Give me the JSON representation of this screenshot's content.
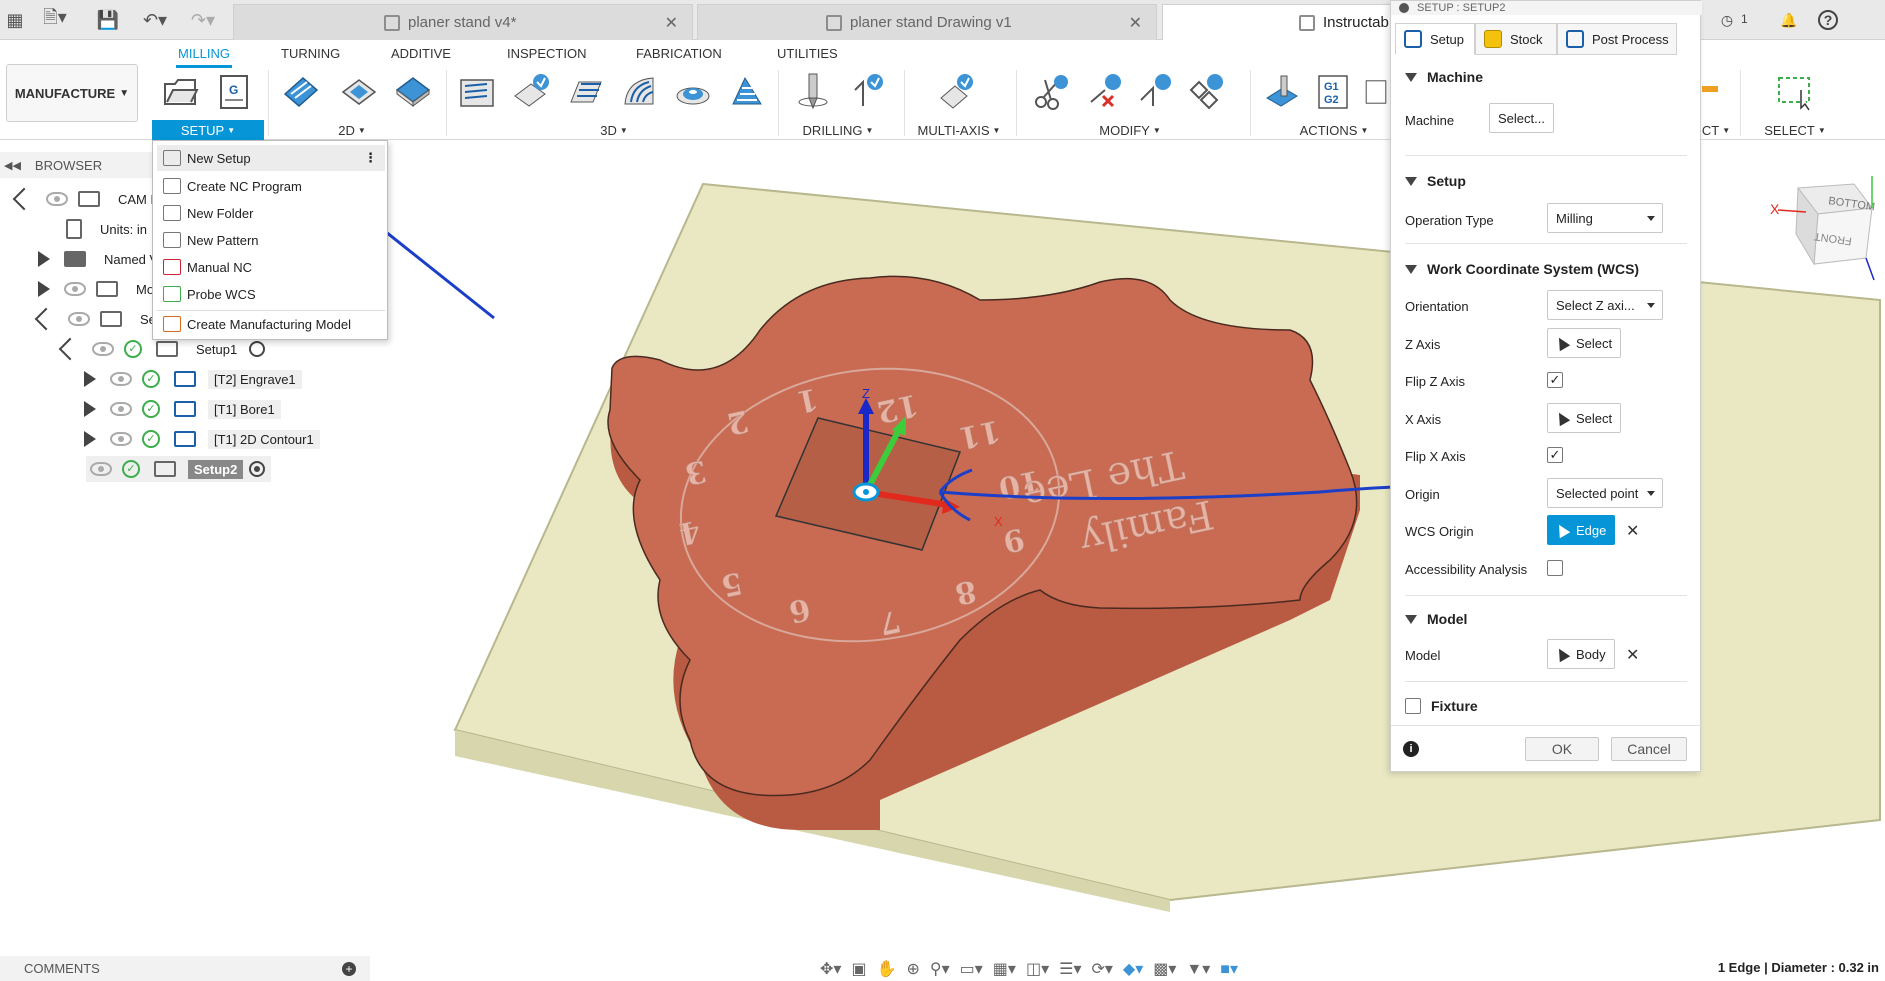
{
  "tabs": [
    {
      "label": "planer stand v4*"
    },
    {
      "label": "planer stand Drawing v1"
    },
    {
      "label": "Instructab"
    }
  ],
  "status_counter": "1",
  "workspace": {
    "label": "MANUFACTURE"
  },
  "ribbon_tabs": [
    "MILLING",
    "TURNING",
    "ADDITIVE",
    "INSPECTION",
    "FABRICATION",
    "UTILITIES"
  ],
  "groups": {
    "setup": "SETUP",
    "twod": "2D",
    "threed": "3D",
    "drilling": "DRILLING",
    "multiaxis": "MULTI-AXIS",
    "modify": "MODIFY",
    "actions": "ACTIONS",
    "inspect": "CT",
    "select": "SELECT"
  },
  "g1g2_label": [
    "G1",
    "G2"
  ],
  "browser": {
    "title": "BROWSER",
    "items": [
      {
        "label": "CAM R"
      },
      {
        "label": "Units: in"
      },
      {
        "label": "Named V"
      },
      {
        "label": "Mo"
      },
      {
        "label": "Se"
      },
      {
        "label": "Setup1"
      },
      {
        "label": "[T2] Engrave1"
      },
      {
        "label": "[T1] Bore1"
      },
      {
        "label": "[T1] 2D Contour1"
      },
      {
        "label": "Setup2"
      }
    ]
  },
  "setup_menu": {
    "items": [
      {
        "label": "New Setup"
      },
      {
        "label": "Create NC Program"
      },
      {
        "label": "New Folder"
      },
      {
        "label": "New Pattern"
      },
      {
        "label": "Manual NC"
      },
      {
        "label": "Probe WCS"
      },
      {
        "label": "Create Manufacturing Model"
      }
    ]
  },
  "panel": {
    "title": "SETUP : SETUP2",
    "tabs": [
      {
        "label": "Setup"
      },
      {
        "label": "Stock"
      },
      {
        "label": "Post Process"
      }
    ],
    "machine_section": "Machine",
    "machine_label": "Machine",
    "machine_value": "Select...",
    "setup_section": "Setup",
    "operation_type_label": "Operation Type",
    "operation_type_value": "Milling",
    "wcs_section": "Work Coordinate System (WCS)",
    "orientation_label": "Orientation",
    "orientation_value": "Select Z axi...",
    "z_axis_label": "Z Axis",
    "z_axis_value": "Select",
    "flip_z_label": "Flip Z Axis",
    "x_axis_label": "X Axis",
    "x_axis_value": "Select",
    "flip_x_label": "Flip X Axis",
    "origin_label": "Origin",
    "origin_value": "Selected point",
    "wcs_origin_label": "WCS Origin",
    "wcs_origin_value": "Edge",
    "accessibility_label": "Accessibility Analysis",
    "model_section": "Model",
    "model_label": "Model",
    "model_value": "Body",
    "fixture_section": "Fixture",
    "ok": "OK",
    "cancel": "Cancel"
  },
  "viewcube": {
    "top": "BOTTOM",
    "front": "FRONT",
    "axis_x": "X"
  },
  "engraving": {
    "line1": "The Lee",
    "line2": "Family",
    "clock_numbers": [
      "1",
      "2",
      "3",
      "4",
      "5",
      "6",
      "7",
      "8",
      "9",
      "10",
      "11",
      "12"
    ]
  },
  "axis_labels": {
    "z": "Z",
    "x": "X"
  },
  "comments": {
    "label": "COMMENTS"
  },
  "status_bar": "1 Edge | Diameter : 0.32 in",
  "colors": {
    "accent": "#0696d7",
    "part": "#c86b52",
    "stock": "#e8e7bf",
    "annotation": "#1c3fc9"
  }
}
